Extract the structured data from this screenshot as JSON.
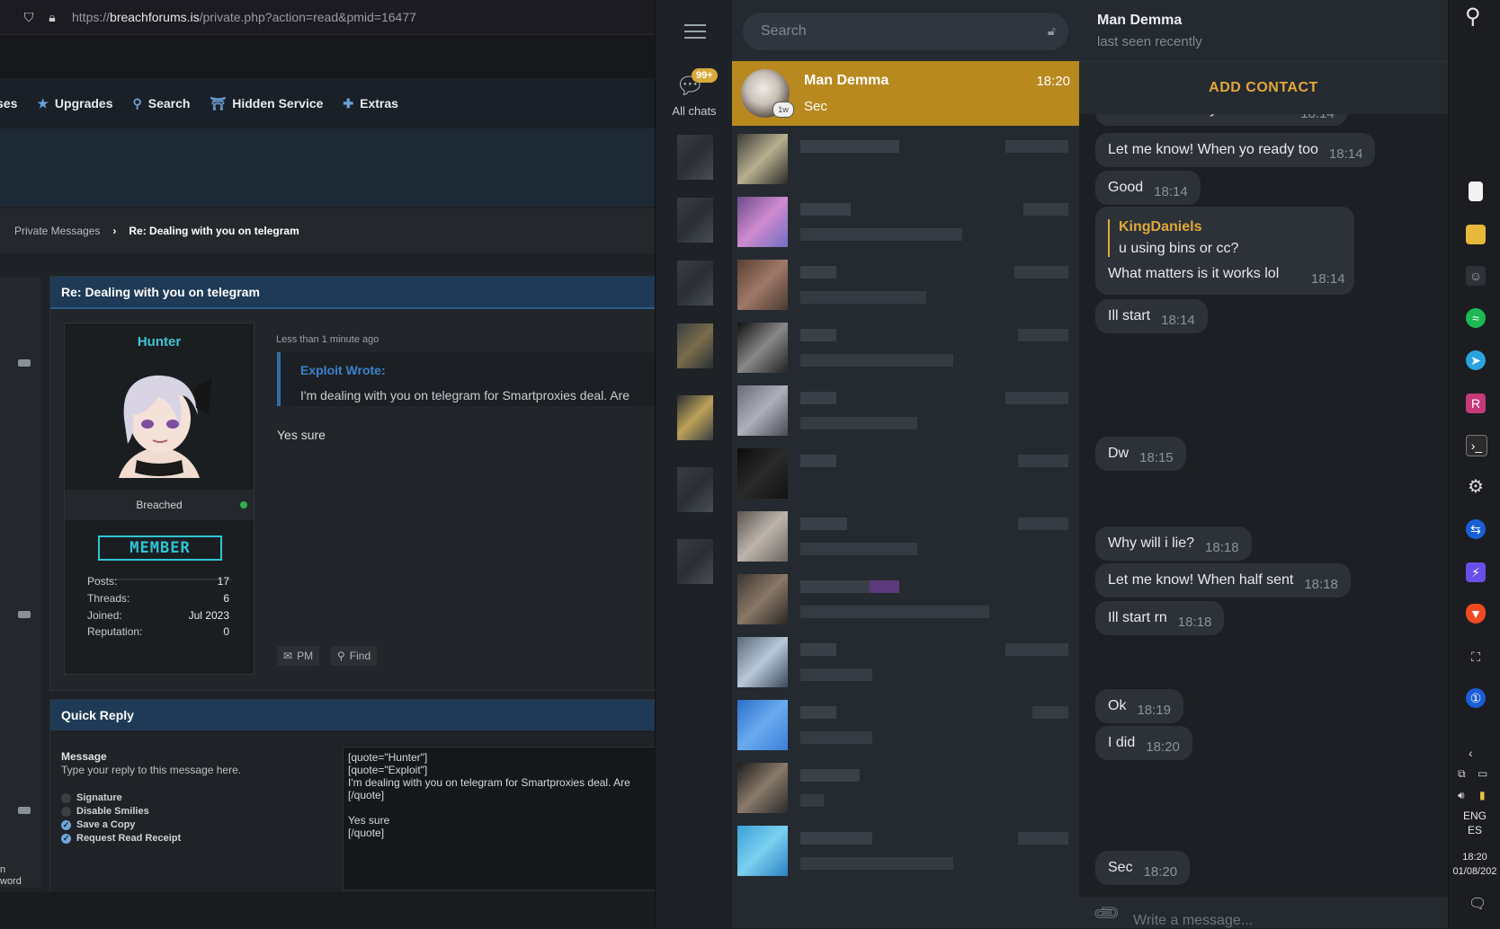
{
  "browser": {
    "url_prefix": "https://",
    "url_host": "breachforums.is",
    "url_path": "/private.php?action=read&pmid=16477",
    "nav": [
      {
        "label": "ses",
        "icon": "none"
      },
      {
        "label": "Upgrades",
        "icon": "star-icon"
      },
      {
        "label": "Search",
        "icon": "search-icon"
      },
      {
        "label": "Hidden Service",
        "icon": "onion-icon"
      },
      {
        "label": "Extras",
        "icon": "plus-icon"
      }
    ],
    "breadcrumb": {
      "parent": "Private Messages",
      "separator": "›",
      "current": "Re: Dealing with you on telegram"
    },
    "post": {
      "title": "Re: Dealing with you on telegram",
      "username": "Hunter",
      "user_title": "Breached",
      "rank": "MEMBER",
      "stats": [
        {
          "label": "Posts:",
          "value": "17"
        },
        {
          "label": "Threads:",
          "value": "6"
        },
        {
          "label": "Joined:",
          "value": "Jul 2023"
        },
        {
          "label": "Reputation:",
          "value": "0"
        }
      ],
      "time": "Less than 1 minute ago",
      "quote_author": "Exploit Wrote:",
      "quote_text": "I'm dealing with you on telegram for Smartproxies deal. Are",
      "message": "Yes sure",
      "pm_label": "PM",
      "find_label": "Find"
    },
    "quick_reply": {
      "title": "Quick Reply",
      "label": "Message",
      "sublabel": "Type your reply to this message here.",
      "options": [
        {
          "label": "Signature",
          "checked": false
        },
        {
          "label": "Disable Smilies",
          "checked": false
        },
        {
          "label": "Save a Copy",
          "checked": true
        },
        {
          "label": "Request Read Receipt",
          "checked": true
        }
      ],
      "text": "[quote=\"Hunter\"]\n[quote=\"Exploit\"]\nI'm dealing with you on telegram for Smartproxies deal. Are\n[/quote]\n\nYes sure\n[/quote]"
    },
    "left_snippets": [
      "n",
      "word"
    ]
  },
  "telegram": {
    "folder_badge": "99+",
    "folder_label": "All chats",
    "search_placeholder": "Search",
    "active_chat": {
      "name": "Man Demma",
      "time": "18:20",
      "preview": "Sec",
      "badge": "1w"
    },
    "header": {
      "name": "Man Demma",
      "status": "last seen recently"
    },
    "add_contact": "ADD CONTACT",
    "partial_message": {
      "text": "You will definitely need more",
      "time": "18:14"
    },
    "messages": [
      {
        "text": "Let me know! When yo ready too",
        "time": "18:14"
      },
      {
        "text": "Good",
        "time": "18:14"
      },
      {
        "text": "Ill start",
        "time": "18:14"
      },
      {
        "text": "Dw",
        "time": "18:15"
      },
      {
        "text": "Why will i lie?",
        "time": "18:18"
      },
      {
        "text": "Let me know! When half sent",
        "time": "18:18"
      },
      {
        "text": "Ill start rn",
        "time": "18:18"
      },
      {
        "text": "Ok",
        "time": "18:19"
      },
      {
        "text": "I did",
        "time": "18:20"
      },
      {
        "text": "Sec",
        "time": "18:20"
      }
    ],
    "reply_message": {
      "author": "KingDaniels",
      "quote": "u using bins or cc?",
      "text": "What matters is it works lol",
      "time": "18:14"
    },
    "compose_placeholder": "Write a message..."
  },
  "taskbar": {
    "lang": "ENG",
    "lang_sub": "ES",
    "time": "18:20",
    "date": "01/08/202"
  },
  "colors": {
    "accent_gold": "#b8891f",
    "telegram_link": "#e0a83a",
    "forum_cyan": "#2ec7d6",
    "forum_blue": "#1f3a56"
  }
}
